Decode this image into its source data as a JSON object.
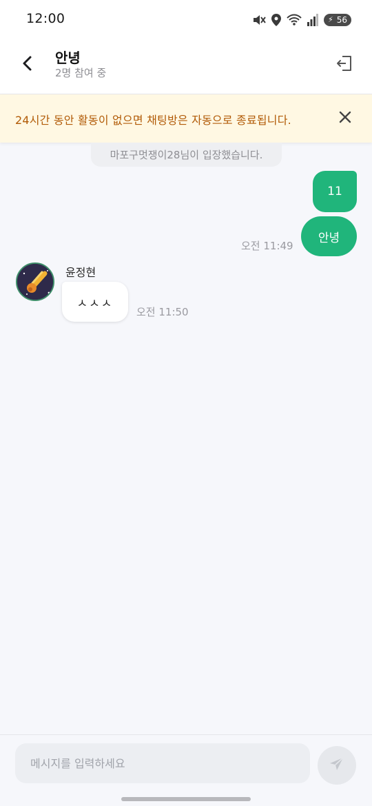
{
  "status_bar": {
    "time": "12:00",
    "battery": "56",
    "icons": [
      "mute-icon",
      "location-icon",
      "wifi-icon",
      "signal-icon",
      "battery-icon"
    ]
  },
  "header": {
    "title": "안녕",
    "subtitle": "2명 참여 중",
    "back_icon": "chevron-left-icon",
    "exit_icon": "exit-icon"
  },
  "notice": {
    "text": "24시간 동안 활동이 없으면 채팅방은 자동으로 종료됩니다.",
    "close_icon": "close-icon"
  },
  "messages": {
    "system": "마포구멋쟁이28님이 입장했습니다.",
    "outgoing": [
      {
        "text": "11"
      },
      {
        "text": "안녕"
      }
    ],
    "outgoing_time": "오전 11:49",
    "incoming": {
      "sender": "윤정현",
      "text": "ㅅㅅㅅ",
      "time": "오전 11:50"
    }
  },
  "composer": {
    "placeholder": "메시지를 입력하세요",
    "send_icon": "send-icon"
  },
  "colors": {
    "accent": "#20b57b",
    "notice_bg": "#fff8e3",
    "notice_text": "#b15a06"
  }
}
